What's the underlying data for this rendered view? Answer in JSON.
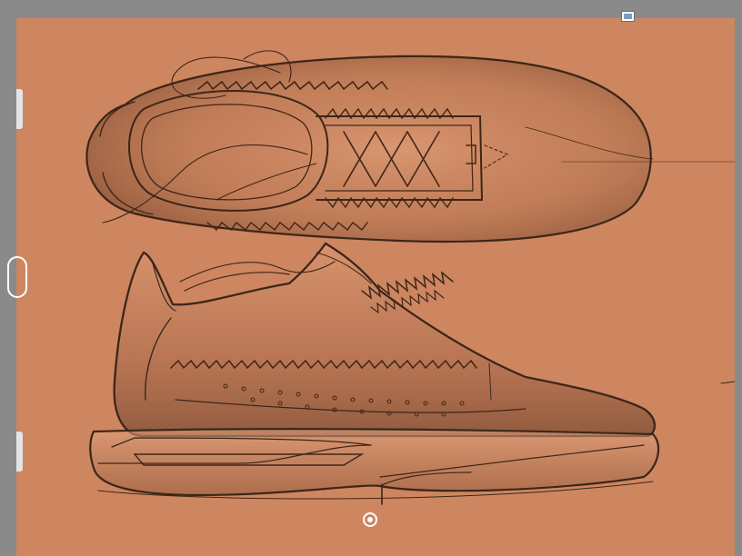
{
  "app": {
    "name": "",
    "background_color": "#8a8a8a",
    "canvas_color": "#cd8660"
  },
  "controls": {
    "left_edge_handles": [
      "resize-handle-top",
      "resize-handle-bottom"
    ],
    "center_handle_icon": "drag-handle-icon",
    "top_widget_icon": "layer-thumbnail-icon",
    "bottom_control_icon": "rotate-icon"
  },
  "artwork": {
    "subject": "",
    "stroke_color": "#3d2618",
    "shade_color": "#7a4a31",
    "highlight_color": "#e9ab85"
  }
}
